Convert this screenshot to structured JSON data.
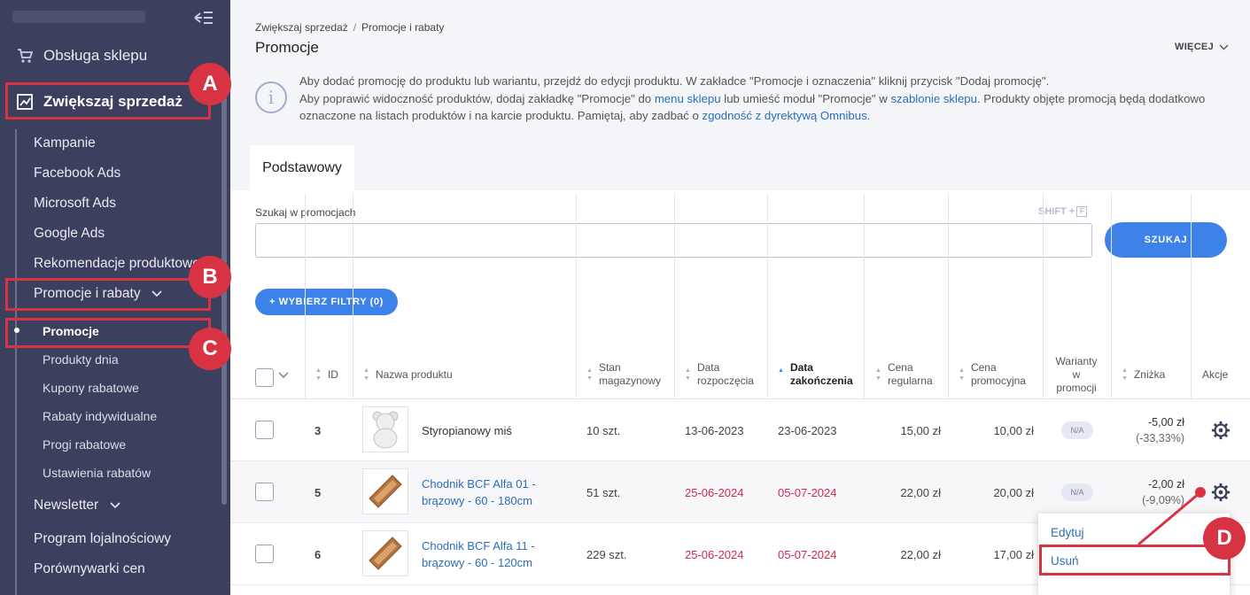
{
  "sidebar": {
    "main_items": [
      {
        "label": "Obsługa sklepu",
        "icon": "cart-icon"
      },
      {
        "label": "Zwiększaj sprzedaż",
        "icon": "chart-icon"
      }
    ],
    "items": [
      "Kampanie",
      "Facebook Ads",
      "Microsoft Ads",
      "Google Ads",
      "Rekomendacje produktowe",
      "Promocje i rabaty"
    ],
    "sub_items": [
      "Promocje",
      "Produkty dnia",
      "Kupony rabatowe",
      "Rabaty indywidualne",
      "Progi rabatowe",
      "Ustawienia rabatów"
    ],
    "bottom_items": [
      "Newsletter",
      "Program lojalnościowy",
      "Porównywarki cen"
    ]
  },
  "breadcrumb": {
    "root": "Zwiększaj sprzedaż",
    "sep": "/",
    "current": "Promocje i rabaty"
  },
  "page_title": "Promocje",
  "more_label": "WIĘCEJ",
  "info": {
    "line1": "Aby dodać promocję do produktu lub wariantu, przejdź do edycji produktu. W zakładce \"Promocje i oznaczenia\" kliknij przycisk \"Dodaj promocję\".",
    "line2a": "Aby poprawić widoczność produktów, dodaj zakładkę \"Promocje\" do ",
    "link1": "menu sklepu",
    "line2b": " lub umieść moduł \"Promocje\" w ",
    "link2": "szablonie sklepu",
    "line2c": ". Produkty objęte promocją będą dodatkowo oznaczone na listach produktów i na karcie produktu. Pamiętaj, aby zadbać o ",
    "link3": "zgodność z dyrektywą Omnibus",
    "line2d": "."
  },
  "tab_label": "Podstawowy",
  "search": {
    "label": "Szukaj w promocjach",
    "shortcut": "SHIFT +",
    "shortcut_key": "F",
    "value": "",
    "button": "SZUKAJ"
  },
  "filter_button": "+ WYBIERZ FILTRY (0)",
  "columns": {
    "id": "ID",
    "name": "Nazwa produktu",
    "stock_1": "Stan",
    "stock_2": "magazynowy",
    "start_1": "Data",
    "start_2": "rozpoczęcia",
    "end_1": "Data",
    "end_2": "zakończenia",
    "regular_1": "Cena",
    "regular_2": "regularna",
    "promo_1": "Cena",
    "promo_2": "promocyjna",
    "variants_1": "Warianty",
    "variants_2": "w",
    "variants_3": "promocji",
    "discount": "Zniżka",
    "actions": "Akcje"
  },
  "rows": [
    {
      "id": "3",
      "name_1": "Styropianowy miś",
      "name_2": "",
      "stock": "10 szt.",
      "start": "13-06-2023",
      "end": "23-06-2023",
      "regular": "15,00 zł",
      "promo": "10,00 zł",
      "variants": "N/A",
      "discount": "-5,00 zł",
      "discount_pct": "(-33,33%)"
    },
    {
      "id": "5",
      "name_1": "Chodnik BCF Alfa 01 -",
      "name_2": "brązowy - 60 - 180cm",
      "stock": "51 szt.",
      "start": "25-06-2024",
      "end": "05-07-2024",
      "regular": "22,00 zł",
      "promo": "20,00 zł",
      "variants": "N/A",
      "discount": "-2,00 zł",
      "discount_pct": "(-9,09%)"
    },
    {
      "id": "6",
      "name_1": "Chodnik BCF Alfa 11 -",
      "name_2": "brązowy - 60 - 120cm",
      "stock": "229 szt.",
      "start": "25-06-2024",
      "end": "05-07-2024",
      "regular": "22,00 zł",
      "promo": "17,00 zł"
    }
  ],
  "dropdown": {
    "edit": "Edytuj",
    "delete": "Usuń"
  },
  "annotations": {
    "a": "A",
    "b": "B",
    "c": "C",
    "d": "D"
  },
  "colors": {
    "sidebar": "#3c3f5e",
    "accent": "#3d82e8",
    "annotation": "#d73343",
    "link": "#2a6ebb",
    "date_red": "#d0284f"
  }
}
